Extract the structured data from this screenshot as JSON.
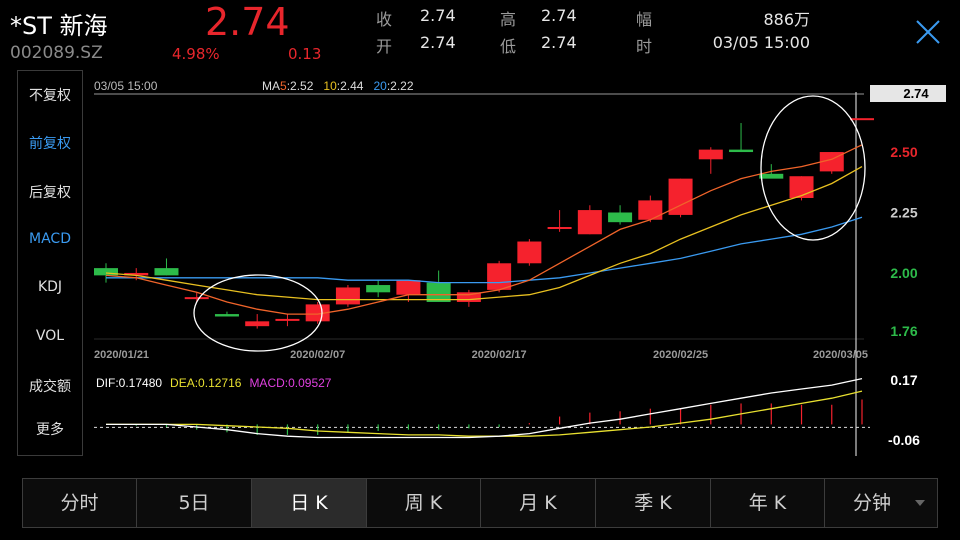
{
  "header": {
    "name": "*ST 新海",
    "code": "002089.SZ",
    "price": "2.74",
    "change_pct": "4.98%",
    "change_amt": "0.13",
    "quote": [
      {
        "label": "收",
        "value": "2.74"
      },
      {
        "label": "开",
        "value": "2.74"
      },
      {
        "label": "高",
        "value": "2.74"
      },
      {
        "label": "低",
        "value": "2.74"
      },
      {
        "label": "幅",
        "value": "886万"
      },
      {
        "label": "时",
        "value": "03/05 15:00"
      }
    ]
  },
  "sidebar": {
    "items": [
      {
        "label": "不复权",
        "active": false
      },
      {
        "label": "前复权",
        "active": true
      },
      {
        "label": "后复权",
        "active": false
      },
      {
        "label": "MACD",
        "active": true
      },
      {
        "label": "KDJ",
        "active": false
      },
      {
        "label": "VOL",
        "active": false
      },
      {
        "label": "成交额",
        "active": false
      },
      {
        "label": "更多",
        "active": false
      }
    ]
  },
  "chart_data": {
    "type": "candlestick",
    "time_label": "03/05 15:00",
    "ma_label": "MA",
    "ma": [
      {
        "period": "5",
        "value": "2.52",
        "color": "#f0642a"
      },
      {
        "period": "10",
        "value": "2.44",
        "color": "#e8c020"
      },
      {
        "period": "20",
        "value": "2.22",
        "color": "#3a9af0"
      }
    ],
    "y_ticks": [
      {
        "label": "2.74",
        "value": 2.74,
        "color": "#ffffff"
      },
      {
        "label": "2.50",
        "value": 2.5,
        "color": "#e8262c"
      },
      {
        "label": "2.25",
        "value": 2.25,
        "color": "#cccccc"
      },
      {
        "label": "2.00",
        "value": 2.0,
        "color": "#2dbb4a"
      },
      {
        "label": "1.76",
        "value": 1.76,
        "color": "#2dbb4a"
      }
    ],
    "ylim": [
      1.76,
      2.74
    ],
    "x_ticks": [
      {
        "label": "2020/01/21",
        "index": 0
      },
      {
        "label": "2020/02/07",
        "index": 7
      },
      {
        "label": "2020/02/17",
        "index": 13
      },
      {
        "label": "2020/02/25",
        "index": 19
      },
      {
        "label": "2020/03/05",
        "index": 25
      }
    ],
    "candles": [
      {
        "o": 2.02,
        "h": 2.04,
        "l": 1.96,
        "c": 1.99
      },
      {
        "o": 1.99,
        "h": 2.02,
        "l": 1.97,
        "c": 2.0
      },
      {
        "o": 2.02,
        "h": 2.06,
        "l": 1.99,
        "c": 1.99
      },
      {
        "o": 1.9,
        "h": 1.92,
        "l": 1.88,
        "c": 1.9
      },
      {
        "o": 1.83,
        "h": 1.84,
        "l": 1.82,
        "c": 1.82
      },
      {
        "o": 1.78,
        "h": 1.83,
        "l": 1.77,
        "c": 1.8
      },
      {
        "o": 1.81,
        "h": 1.83,
        "l": 1.78,
        "c": 1.81
      },
      {
        "o": 1.8,
        "h": 1.88,
        "l": 1.79,
        "c": 1.87
      },
      {
        "o": 1.87,
        "h": 1.95,
        "l": 1.86,
        "c": 1.94
      },
      {
        "o": 1.95,
        "h": 1.97,
        "l": 1.9,
        "c": 1.92
      },
      {
        "o": 1.91,
        "h": 1.97,
        "l": 1.88,
        "c": 1.97
      },
      {
        "o": 1.96,
        "h": 2.01,
        "l": 1.88,
        "c": 1.88
      },
      {
        "o": 1.88,
        "h": 1.93,
        "l": 1.86,
        "c": 1.92
      },
      {
        "o": 1.93,
        "h": 2.05,
        "l": 1.92,
        "c": 2.04
      },
      {
        "o": 2.04,
        "h": 2.14,
        "l": 2.03,
        "c": 2.13
      },
      {
        "o": 2.19,
        "h": 2.26,
        "l": 2.17,
        "c": 2.19
      },
      {
        "o": 2.16,
        "h": 2.28,
        "l": 2.16,
        "c": 2.26
      },
      {
        "o": 2.25,
        "h": 2.28,
        "l": 2.2,
        "c": 2.21
      },
      {
        "o": 2.22,
        "h": 2.32,
        "l": 2.21,
        "c": 2.3
      },
      {
        "o": 2.24,
        "h": 2.39,
        "l": 2.23,
        "c": 2.39
      },
      {
        "o": 2.47,
        "h": 2.52,
        "l": 2.41,
        "c": 2.51
      },
      {
        "o": 2.51,
        "h": 2.62,
        "l": 2.5,
        "c": 2.5
      },
      {
        "o": 2.41,
        "h": 2.45,
        "l": 2.4,
        "c": 2.39
      },
      {
        "o": 2.31,
        "h": 2.4,
        "l": 2.3,
        "c": 2.4
      },
      {
        "o": 2.42,
        "h": 2.5,
        "l": 2.41,
        "c": 2.5
      },
      {
        "o": 2.64,
        "h": 2.64,
        "l": 2.64,
        "c": 2.64
      }
    ],
    "ma5": [
      1.99,
      1.98,
      1.95,
      1.92,
      1.88,
      1.85,
      1.83,
      1.83,
      1.85,
      1.88,
      1.91,
      1.91,
      1.91,
      1.93,
      1.97,
      2.04,
      2.11,
      2.18,
      2.22,
      2.28,
      2.34,
      2.39,
      2.42,
      2.44,
      2.47,
      2.53
    ],
    "ma10": [
      2.0,
      1.99,
      1.97,
      1.95,
      1.93,
      1.91,
      1.9,
      1.89,
      1.89,
      1.89,
      1.89,
      1.89,
      1.89,
      1.9,
      1.91,
      1.94,
      1.99,
      2.04,
      2.08,
      2.14,
      2.19,
      2.24,
      2.28,
      2.32,
      2.37,
      2.44
    ],
    "ma20": [
      1.98,
      1.98,
      1.98,
      1.98,
      1.98,
      1.98,
      1.98,
      1.98,
      1.97,
      1.97,
      1.97,
      1.96,
      1.96,
      1.96,
      1.97,
      1.98,
      2.0,
      2.02,
      2.04,
      2.06,
      2.09,
      2.12,
      2.14,
      2.16,
      2.19,
      2.23
    ],
    "macd_panel": {
      "dif_label": "DIF:0.17480",
      "dea_label": "DEA:0.12716",
      "macd_label": "MACD:0.09527",
      "y_ticks": [
        {
          "label": "0.17",
          "value": 0.17
        },
        {
          "label": "-0.06",
          "value": -0.06
        }
      ],
      "ylim": [
        -0.09,
        0.2
      ],
      "dif": [
        0.0,
        0.0,
        0.0,
        -0.01,
        -0.02,
        -0.035,
        -0.045,
        -0.05,
        -0.05,
        -0.05,
        -0.05,
        -0.05,
        -0.05,
        -0.045,
        -0.035,
        -0.015,
        0.005,
        0.02,
        0.04,
        0.06,
        0.08,
        0.1,
        0.12,
        0.135,
        0.15,
        0.175
      ],
      "dea": [
        0.0,
        0.0,
        0.0,
        0.0,
        -0.005,
        -0.01,
        -0.015,
        -0.025,
        -0.03,
        -0.035,
        -0.04,
        -0.04,
        -0.045,
        -0.045,
        -0.045,
        -0.04,
        -0.03,
        -0.02,
        -0.01,
        0.005,
        0.02,
        0.04,
        0.06,
        0.08,
        0.1,
        0.127
      ],
      "macd": [
        0.0,
        -0.005,
        -0.01,
        -0.02,
        -0.03,
        -0.04,
        -0.04,
        -0.04,
        -0.03,
        -0.025,
        -0.02,
        -0.02,
        -0.015,
        -0.01,
        0.005,
        0.03,
        0.045,
        0.05,
        0.06,
        0.06,
        0.075,
        0.08,
        0.08,
        0.075,
        0.075,
        0.095
      ]
    }
  },
  "tabs": [
    {
      "label": "分时",
      "active": false
    },
    {
      "label": "5日",
      "active": false
    },
    {
      "label": "日 K",
      "active": true
    },
    {
      "label": "周 K",
      "active": false
    },
    {
      "label": "月 K",
      "active": false
    },
    {
      "label": "季 K",
      "active": false
    },
    {
      "label": "年 K",
      "active": false
    },
    {
      "label": "分钟",
      "active": false
    }
  ]
}
